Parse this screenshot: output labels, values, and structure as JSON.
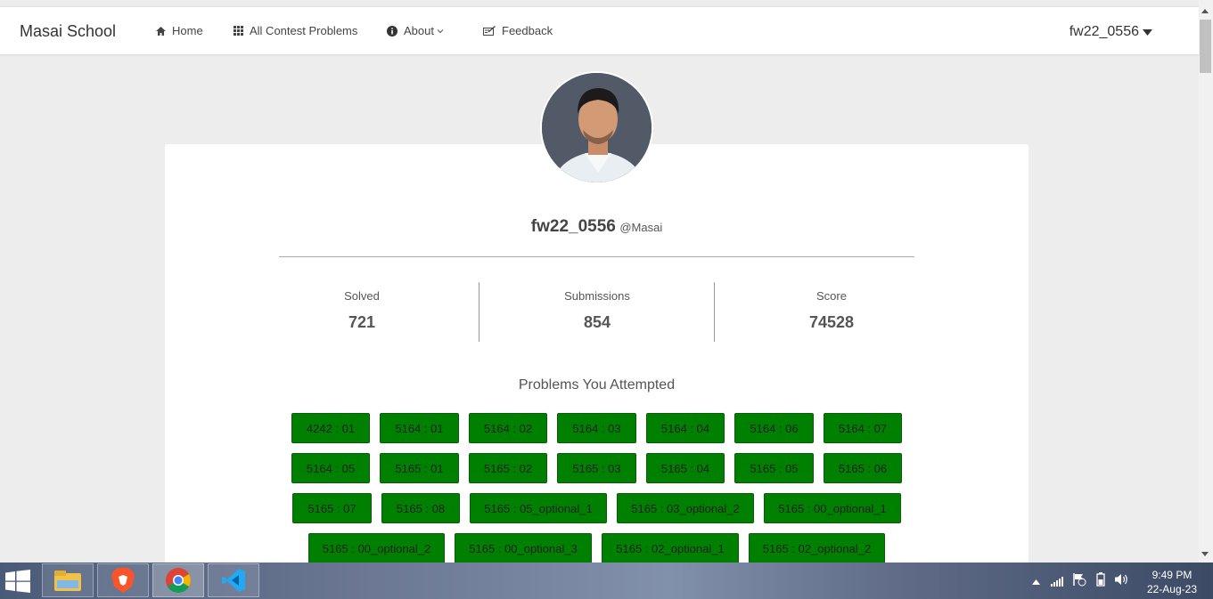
{
  "navbar": {
    "brand": "Masai School",
    "home_label": "Home",
    "contests_label": "All Contest Problems",
    "about_label": "About",
    "feedback_label": "Feedback",
    "user_label": "fw22_0556"
  },
  "profile": {
    "username": "fw22_0556",
    "org": "@Masai"
  },
  "stats": [
    {
      "label": "Solved",
      "value": "721"
    },
    {
      "label": "Submissions",
      "value": "854"
    },
    {
      "label": "Score",
      "value": "74528"
    }
  ],
  "problems_title": "Problems You Attempted",
  "problems": [
    "4242 : 01",
    "5164 : 01",
    "5164 : 02",
    "5164 : 03",
    "5164 : 04",
    "5164 : 06",
    "5164 : 07",
    "5164 : 05",
    "5165 : 01",
    "5165 : 02",
    "5165 : 03",
    "5165 : 04",
    "5165 : 05",
    "5165 : 06",
    "5165 : 07",
    "5165 : 08",
    "5165 : 05_optional_1",
    "5165 : 03_optional_2",
    "5165 : 00_optional_1",
    "5165 : 00_optional_2",
    "5165 : 00_optional_3",
    "5165 : 02_optional_1",
    "5165 : 02_optional_2"
  ],
  "taskbar": {
    "apps": [
      "file-explorer",
      "brave-browser",
      "chrome-browser",
      "vscode"
    ],
    "time": "9:49 PM",
    "date": "22-Aug-23"
  },
  "colors": {
    "problem_button": "#008000",
    "page_bg": "#ededed"
  }
}
